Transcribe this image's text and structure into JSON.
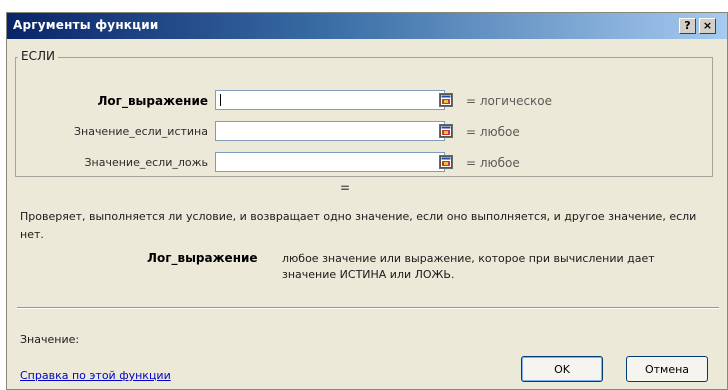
{
  "dialog": {
    "title": "Аргументы функции",
    "help_button": "?",
    "close_button": "×"
  },
  "function_group": {
    "name": "ЕСЛИ",
    "args": [
      {
        "label": "Лог_выражение",
        "value": "",
        "result": "=  логическое",
        "bold": true
      },
      {
        "label": "Значение_если_истина",
        "value": "",
        "result": "=  любое",
        "bold": false
      },
      {
        "label": "Значение_если_ложь",
        "value": "",
        "result": "=  любое",
        "bold": false
      }
    ]
  },
  "formula_result": "=",
  "description": "Проверяет, выполняется ли условие, и возвращает одно значение, если оно выполняется, и другое значение, если нет.",
  "argument_help": {
    "name": "Лог_выражение",
    "text": "любое значение или выражение, которое при вычислении дает значение ИСТИНА или ЛОЖЬ."
  },
  "value_label": "Значение:",
  "help_link": "Справка по этой функции",
  "buttons": {
    "ok": "OK",
    "cancel": "Отмена"
  },
  "colors": {
    "title_bar_start": "#0a246a",
    "title_bar_end": "#a6caf0",
    "dialog_background": "#ece9d8",
    "link": "#0000cc"
  },
  "icons": {
    "collapse_dialog": "collapse-dialog-icon"
  }
}
